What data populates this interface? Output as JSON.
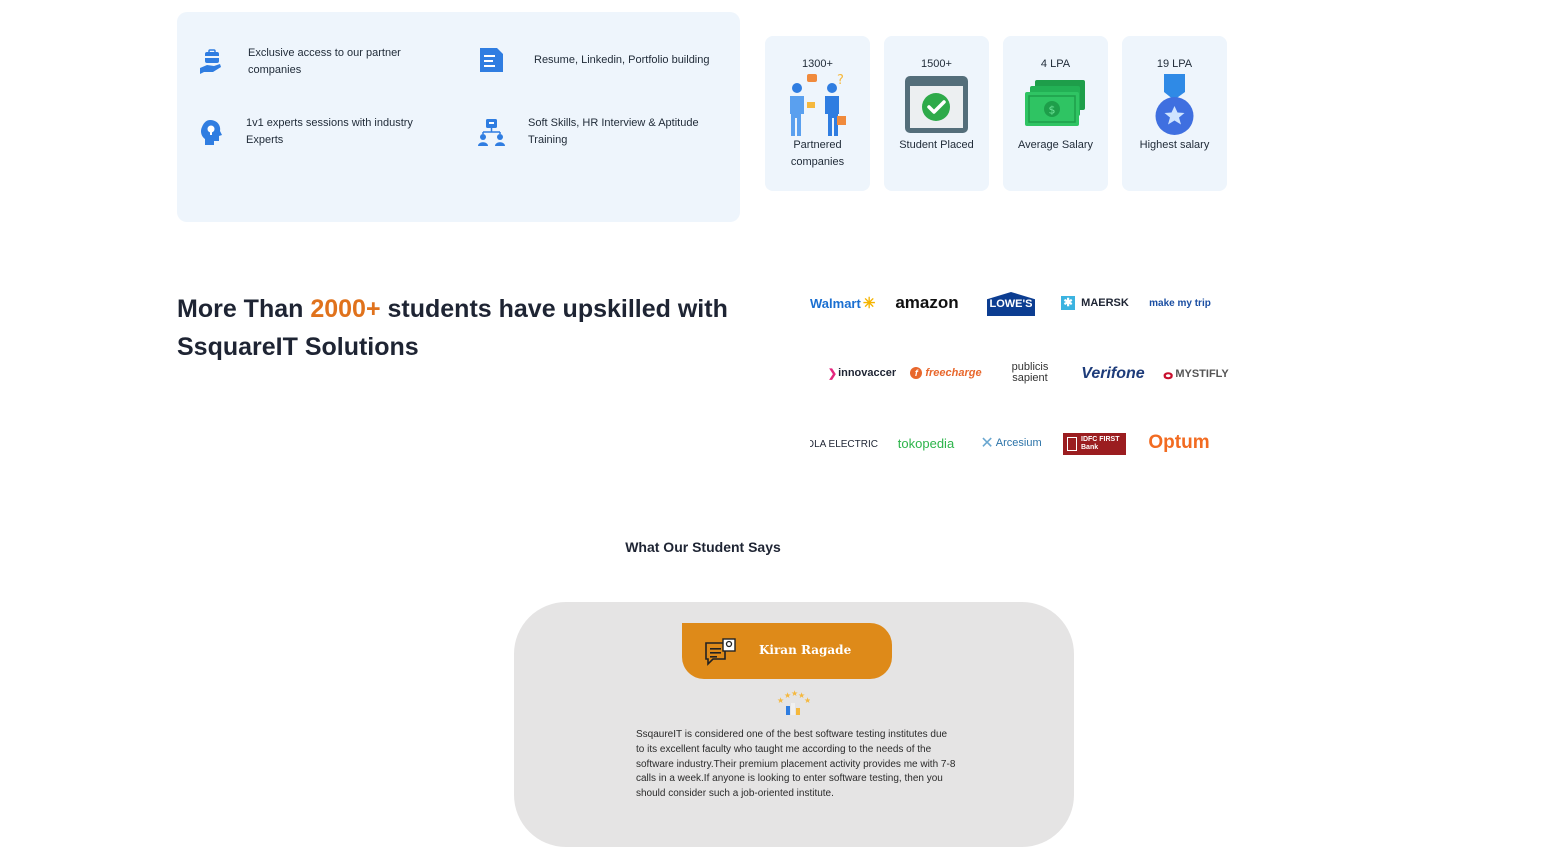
{
  "features": [
    {
      "icon": "briefcase-hand-icon",
      "text": "Exclusive access to our partner companies"
    },
    {
      "icon": "document-icon",
      "text": "Resume, Linkedin, Portfolio building"
    },
    {
      "icon": "head-lightbulb-icon",
      "text": "1v1 experts sessions with industry Experts"
    },
    {
      "icon": "team-hierarchy-icon",
      "text": "Soft Skills, HR Interview & Aptitude Training"
    }
  ],
  "stats": [
    {
      "value": "1300+",
      "label": "Partnered companies",
      "icon": "handshake-people-icon"
    },
    {
      "value": "1500+",
      "label": "Student Placed",
      "icon": "checkmark-window-icon"
    },
    {
      "value": "4 LPA",
      "label": "Average Salary",
      "icon": "money-stack-icon"
    },
    {
      "value": "19 LPA",
      "label": "Highest salary",
      "icon": "medal-icon"
    }
  ],
  "headline": {
    "pre": "More Than ",
    "highlight": "2000+",
    "post": " students have upskilled with SsquareIT Solutions"
  },
  "logos": [
    [
      "Walmart",
      "amazon",
      "LOWE'S",
      "MAERSK",
      "make my trip"
    ],
    [
      "innovaccer",
      "freecharge",
      "publicis sapient",
      "Verifone",
      "MYSTIFLY"
    ],
    [
      "OLA ELECTRIC",
      "tokopedia",
      "Arcesium",
      "IDFC FIRST Bank",
      "Optum"
    ]
  ],
  "testimonials": {
    "heading": "What Our Student Says",
    "name": "Kiran Ragade",
    "quote": "SsqaureIT is considered one of the best software testing institutes due to its excellent faculty who taught me according to the needs of the software industry.Their premium placement activity provides me with 7-8 calls in a week.If anyone is looking to enter software testing, then you should consider such a job-oriented institute."
  },
  "colors": {
    "accent": "#e0721c",
    "card_bg": "#eef5fc",
    "icon_blue": "#2f7de1",
    "tab_orange": "#de8a19"
  }
}
